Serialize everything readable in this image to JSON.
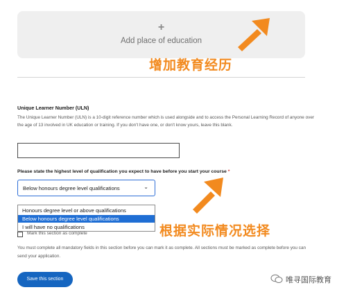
{
  "add_education": {
    "plus_symbol": "+",
    "label": "Add place of education"
  },
  "annotations": {
    "add_education_cn": "增加教育经历",
    "choose_cn": "根据实际情况选择",
    "color": "#f28a1f"
  },
  "uln": {
    "title": "Unique Learner Number (ULN)",
    "description": "The Unique Learner Number (ULN) is a 10-digit reference number which is used alongside and to access the Personal Learning Record of anyone over the age of 13 involved in UK education or training. If you don't have one, or don't know yours, leave this blank.",
    "value": ""
  },
  "qualification": {
    "question": "Please state the highest level of qualification you expect to have before you start your course",
    "required_marker": "*",
    "selected_value": "Below honours degree level qualifications",
    "options": [
      "Honours degree level or above qualifications",
      "Below honours degree level qualifications",
      "I will have no qualifications"
    ],
    "highlight_color": "#1f6ed4"
  },
  "mark_complete": {
    "label": "Mark this section as complete"
  },
  "complete_note": "You must complete all mandatory fields in this section before you can mark it as complete. All sections must be marked as complete before you can send your application.",
  "save_button": {
    "label": "Save this section",
    "color": "#1565c0"
  },
  "watermark": {
    "icon": "wechat-icon",
    "text": "唯寻国际教育"
  }
}
